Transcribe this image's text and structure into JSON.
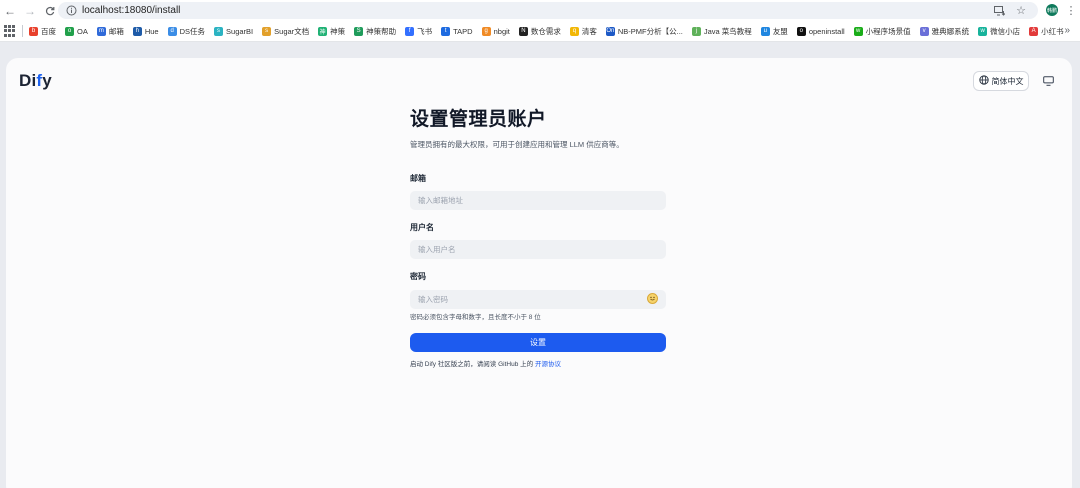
{
  "browser": {
    "url": "localhost:18080/install",
    "profile_initials": "韩鹏",
    "bookmarks": [
      {
        "label": "百度",
        "icon": "baidu-icon",
        "color": "#e8402c",
        "glyph": "b"
      },
      {
        "label": "OA",
        "icon": "oa-icon",
        "color": "#21a04b",
        "glyph": "o"
      },
      {
        "label": "邮箱",
        "icon": "mail-icon",
        "color": "#2f6ad9",
        "glyph": "m"
      },
      {
        "label": "Hue",
        "icon": "hue-icon",
        "color": "#1e5ba8",
        "glyph": "h"
      },
      {
        "label": "DS任务",
        "icon": "ds-icon",
        "color": "#3b8de6",
        "glyph": "d"
      },
      {
        "label": "SugarBI",
        "icon": "sugarbi-icon",
        "color": "#2bb3c2",
        "glyph": "s"
      },
      {
        "label": "Sugar文档",
        "icon": "sugar-doc-icon",
        "color": "#e2a02a",
        "glyph": "s"
      },
      {
        "label": "神策",
        "icon": "sensors-icon",
        "color": "#1fb174",
        "glyph": "神"
      },
      {
        "label": "神策帮助",
        "icon": "sensors-help-icon",
        "color": "#1f9c5b",
        "glyph": "S"
      },
      {
        "label": "飞书",
        "icon": "feishu-icon",
        "color": "#3370ff",
        "glyph": "f"
      },
      {
        "label": "TAPD",
        "icon": "tapd-icon",
        "color": "#1e6be0",
        "glyph": "t"
      },
      {
        "label": "nbgit",
        "icon": "nbgit-icon",
        "color": "#f08a24",
        "glyph": "g"
      },
      {
        "label": "数仓需求",
        "icon": "notion-icon",
        "color": "#222222",
        "glyph": "N"
      },
      {
        "label": "清客",
        "icon": "qingke-icon",
        "color": "#f2b705",
        "glyph": "q"
      },
      {
        "label": "NB-PMF分析【公...",
        "icon": "on-icon",
        "color": "#1d59c6",
        "glyph": "On"
      },
      {
        "label": "Java 菜鸟教程",
        "icon": "runoob-icon",
        "color": "#5fb15a",
        "glyph": "j"
      },
      {
        "label": "友盟",
        "icon": "umeng-icon",
        "color": "#1f86e0",
        "glyph": "u"
      },
      {
        "label": "openinstall",
        "icon": "openinstall-icon",
        "color": "#111111",
        "glyph": "o"
      },
      {
        "label": "小程序场景值",
        "icon": "wechat-icon",
        "color": "#1aad19",
        "glyph": "w"
      },
      {
        "label": "雅典娜系统",
        "icon": "athena-icon",
        "color": "#6a6fd8",
        "glyph": "v"
      },
      {
        "label": "微信小店",
        "icon": "wechat-shop-icon",
        "color": "#17b39b",
        "glyph": "w"
      },
      {
        "label": "小红书",
        "icon": "xiaohongshu-icon",
        "color": "#e23a3a",
        "glyph": "A"
      }
    ]
  },
  "app": {
    "logo_main": "Di",
    "logo_accent": "f",
    "logo_end": "y",
    "language_label": "简体中文"
  },
  "form": {
    "title": "设置管理员账户",
    "subtitle": "管理员拥有的最大权限，可用于创建应用和管理 LLM 供应商等。",
    "email_label": "邮箱",
    "email_placeholder": "输入邮箱地址",
    "username_label": "用户名",
    "username_placeholder": "输入用户名",
    "password_label": "密码",
    "password_placeholder": "输入密码",
    "password_hint": "密码必须包含字母和数字，且长度不小于 8 位",
    "submit_label": "设置",
    "agreement_prefix": "启动 Dify 社区版之前，请阅读 GitHub 上的 ",
    "agreement_link": "开源协议"
  },
  "colors": {
    "primary": "#1d5bef",
    "page_bg": "#e9ebf0",
    "card_bg": "#fbfbfc"
  }
}
